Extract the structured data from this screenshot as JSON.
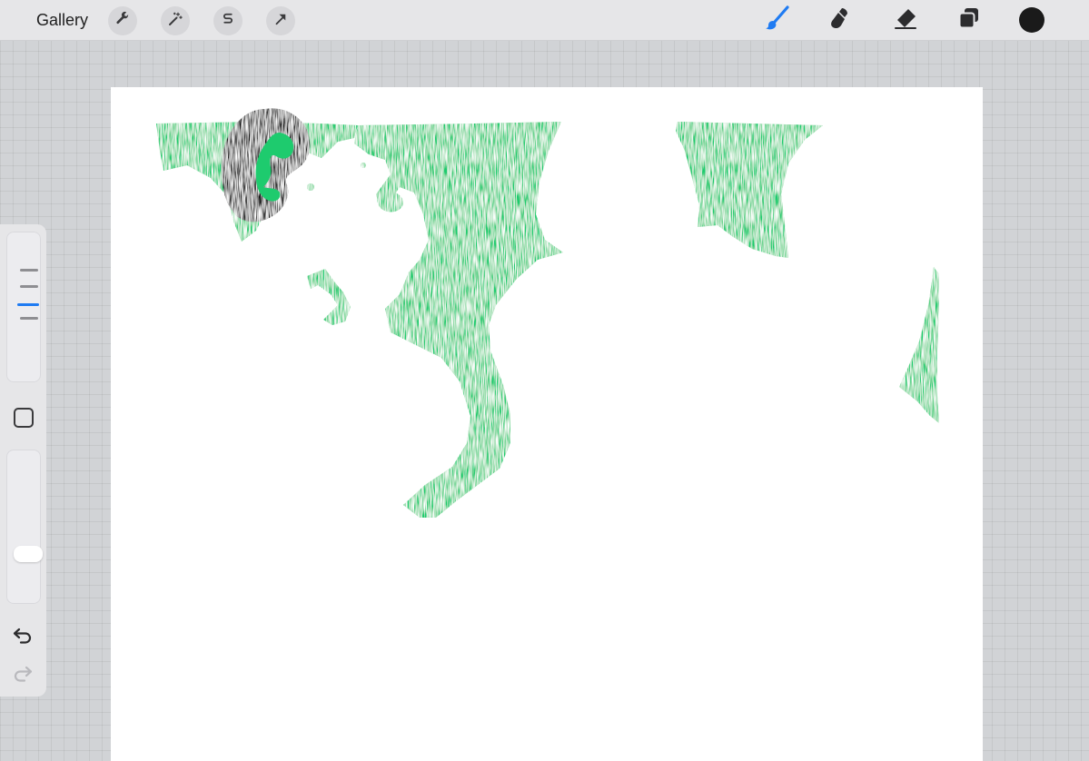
{
  "app": {
    "gallery_label": "Gallery"
  },
  "toolbar_left": {
    "buttons": [
      {
        "icon": "wrench-icon",
        "name": "actions"
      },
      {
        "icon": "magic-wand-icon",
        "name": "adjustments"
      },
      {
        "icon": "selection-s-icon",
        "name": "selection"
      },
      {
        "icon": "transform-arrow-icon",
        "name": "transform"
      }
    ]
  },
  "toolbar_right": {
    "tools": [
      {
        "icon": "brush-icon",
        "name": "paint",
        "active": true,
        "color": "#1f7bf2"
      },
      {
        "icon": "smudge-icon",
        "name": "smudge",
        "active": false
      },
      {
        "icon": "eraser-icon",
        "name": "erase",
        "active": false
      },
      {
        "icon": "layers-icon",
        "name": "layers",
        "active": false
      }
    ],
    "current_color": "#1a1a1a"
  },
  "sidebar": {
    "brush_size_level": 0.35,
    "brush_opacity_level": 0.1,
    "modify_button_icon": "square-icon",
    "undo_icon": "undo-arrow-icon",
    "redo_icon": "redo-arrow-icon"
  },
  "canvas": {
    "background": "#ffffff",
    "strokes": [
      {
        "color": "#1ecb6e",
        "kind": "green-fill"
      },
      {
        "color": "#151515",
        "kind": "black-swirl"
      }
    ]
  }
}
